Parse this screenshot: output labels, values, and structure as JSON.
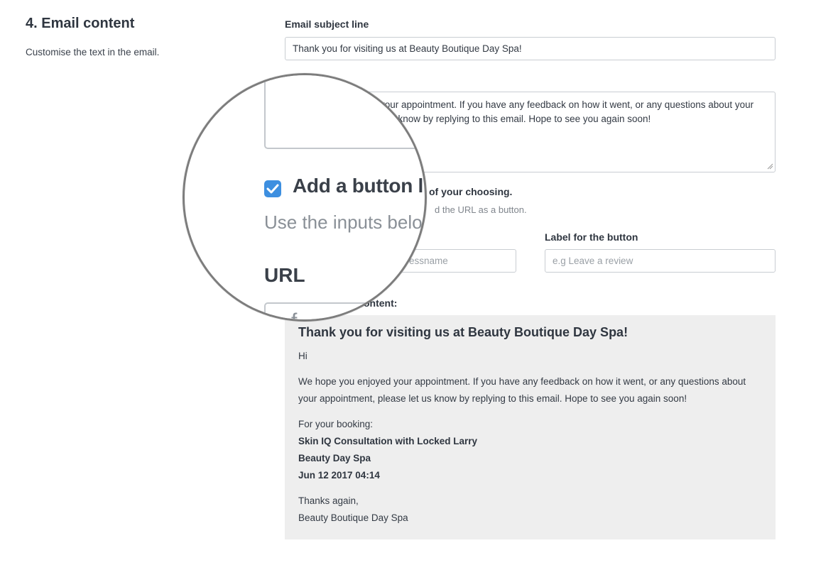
{
  "section": {
    "title": "4. Email content",
    "description": "Customise the text in the email."
  },
  "subject": {
    "label": "Email subject line",
    "value": "Thank you for visiting us at Beauty Boutique Day Spa!"
  },
  "body": {
    "value": "your appointment. If you have any feedback on how it went, or any questions about your\n    s know by replying to this email. Hope to see you again soon!"
  },
  "button_link": {
    "checked": true,
    "label_partial": "of your choosing.",
    "hint_partial": "d the URL as a button.",
    "magnified_label": "Add a button lin",
    "magnified_hint": "Use the inputs belo",
    "magnified_url_label": "URL",
    "magnified_glyph": "f",
    "url_placeholder_partial": "essname",
    "button_label_title": "Label for the button",
    "button_label_placeholder": "e.g Leave a review"
  },
  "preview": {
    "label_partial": "ontent:",
    "heading": "Thank you for visiting us at Beauty Boutique Day Spa!",
    "greeting": "Hi",
    "paragraph_line1": "We hope you enjoyed your appointment. If you have any feedback on how it went, or any questions about",
    "paragraph_line2": "your appointment, please let us know by replying to this email. Hope to see you again soon!",
    "booking_label": "For your booking:",
    "service": "Skin IQ Consultation with Locked Larry",
    "location": "Beauty Day Spa",
    "datetime": "Jun 12 2017 04:14",
    "thanks": "Thanks again,",
    "signature": "Beauty Boutique Day Spa"
  },
  "colors": {
    "accent": "#3d8fe0",
    "preview_bg": "#eeeeee",
    "border": "#c9cdd2"
  }
}
